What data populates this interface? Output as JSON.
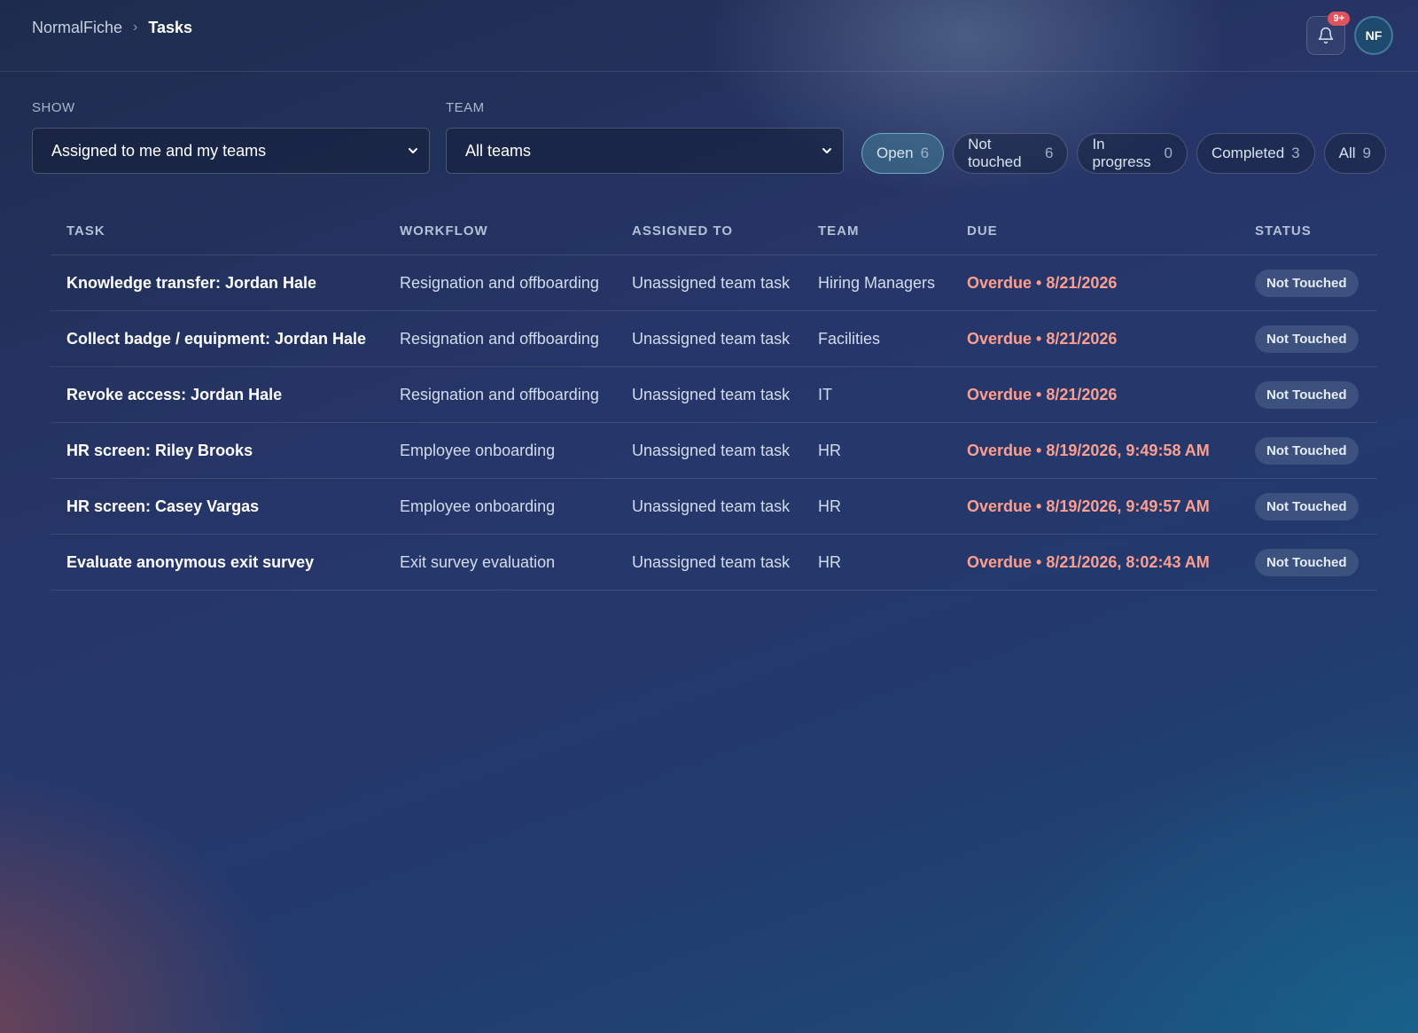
{
  "breadcrumb": {
    "root": "NormalFiche",
    "separator": "›",
    "current": "Tasks"
  },
  "header": {
    "notifications_badge": "9+",
    "avatar_initials": "NF"
  },
  "filters": {
    "show": {
      "label": "SHOW",
      "value": "Assigned to me and my teams"
    },
    "team": {
      "label": "TEAM",
      "value": "All teams"
    }
  },
  "status_pills": [
    {
      "label": "Open",
      "count": "6",
      "active": true
    },
    {
      "label": "Not touched",
      "count": "6",
      "active": false
    },
    {
      "label": "In progress",
      "count": "0",
      "active": false
    },
    {
      "label": "Completed",
      "count": "3",
      "active": false
    },
    {
      "label": "All",
      "count": "9",
      "active": false
    }
  ],
  "table": {
    "columns": [
      "TASK",
      "WORKFLOW",
      "ASSIGNED TO",
      "TEAM",
      "DUE",
      "STATUS"
    ],
    "rows": [
      {
        "task": "Knowledge transfer: Jordan Hale",
        "workflow": "Resignation and offboarding",
        "assigned": "Unassigned team task",
        "team": "Hiring Managers",
        "due": "Overdue • 8/21/2026",
        "status": "Not Touched"
      },
      {
        "task": "Collect badge / equipment: Jordan Hale",
        "workflow": "Resignation and offboarding",
        "assigned": "Unassigned team task",
        "team": "Facilities",
        "due": "Overdue • 8/21/2026",
        "status": "Not Touched"
      },
      {
        "task": "Revoke access: Jordan Hale",
        "workflow": "Resignation and offboarding",
        "assigned": "Unassigned team task",
        "team": "IT",
        "due": "Overdue • 8/21/2026",
        "status": "Not Touched"
      },
      {
        "task": "HR screen: Riley Brooks",
        "workflow": "Employee onboarding",
        "assigned": "Unassigned team task",
        "team": "HR",
        "due": "Overdue • 8/19/2026, 9:49:58 AM",
        "status": "Not Touched"
      },
      {
        "task": "HR screen: Casey Vargas",
        "workflow": "Employee onboarding",
        "assigned": "Unassigned team task",
        "team": "HR",
        "due": "Overdue • 8/19/2026, 9:49:57 AM",
        "status": "Not Touched"
      },
      {
        "task": "Evaluate anonymous exit survey",
        "workflow": "Exit survey evaluation",
        "assigned": "Unassigned team task",
        "team": "HR",
        "due": "Overdue • 8/21/2026, 8:02:43 AM",
        "status": "Not Touched"
      }
    ]
  },
  "colors": {
    "overdue": "#ff9e8c",
    "badge": "#e0525d",
    "active_pill": "#468ca0"
  }
}
